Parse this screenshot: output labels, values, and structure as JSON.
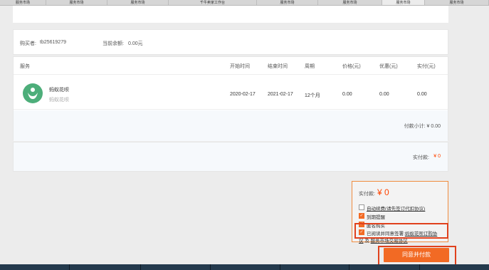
{
  "tabs": [
    {
      "label": "服务市场",
      "active": false
    },
    {
      "label": "服务市场",
      "active": false
    },
    {
      "label": "服务市场",
      "active": false
    },
    {
      "label": "千牛卖家工作台",
      "active": false
    },
    {
      "label": "服务市场",
      "active": false
    },
    {
      "label": "服务市场",
      "active": false
    },
    {
      "label": "服务市场",
      "active": true
    },
    {
      "label": "服务市场",
      "active": false
    }
  ],
  "buyer": {
    "buyer_label": "购买者:",
    "buyer_name": "tb25619279",
    "balance_label": "当前余额:",
    "balance_value": "0.00元"
  },
  "services": {
    "headers": {
      "service": "服务",
      "start": "开始时间",
      "end": "结束时间",
      "period": "周期",
      "price": "价格(元)",
      "discount": "优惠(元)",
      "paid": "实付(元)"
    },
    "items": [
      {
        "name": "蚂蚁花呗",
        "subtitle": "蚂蚁花呗",
        "start": "2020-02-17",
        "end": "2021-02-17",
        "period": "12个月",
        "price": "0.00",
        "discount": "0.00",
        "paid": "0.00"
      }
    ],
    "subtotal": "付款小计: ¥ 0.00"
  },
  "payment": {
    "label": "实付款:",
    "value": "¥ 0"
  },
  "confirm": {
    "total_label": "实付款:",
    "total_value": "¥ 0",
    "auto_renew": "自动续费(请先签订代扣协议)",
    "expire_remind": "到期提醒",
    "anonymous": "匿名购买",
    "agree_prefix": "已阅读并同意签署:",
    "agree_link1": "蚂蚁花呗订购协",
    "agree_line2_prefix": "议",
    "agree_and": "及",
    "agree_link2": "服务市场交易协议",
    "pay_button": "同意并付款"
  }
}
